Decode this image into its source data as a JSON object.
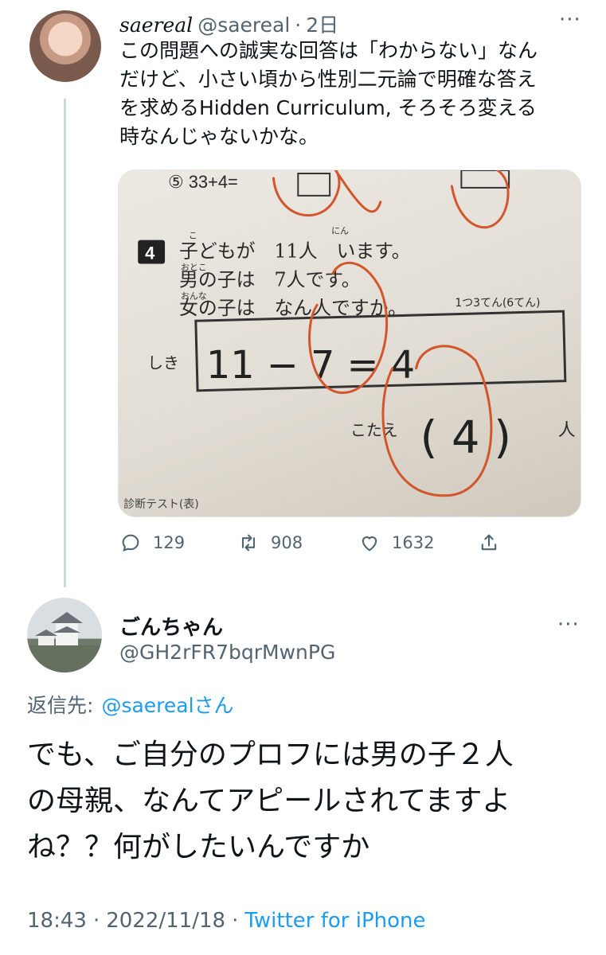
{
  "tweet1": {
    "display_name": "saereal",
    "handle": "@saereal",
    "separator": "·",
    "time": "2日",
    "more": "···",
    "text": "この問題への誠実な回答は「わからない」なん\nだけど、小さい頃から性別二元論で明確な答え\nを求めるHidden Curriculum, そろそろ変える\n時なんじゃないかな。",
    "media": {
      "problem_top": "⑤ 33+4=",
      "problem_number": "4",
      "line1": "子どもが　11人　います。",
      "line2": "男の子は　7人です。",
      "line3": "女の子は　なん人ですか。",
      "points": "1つ3てん(6てん)",
      "ruby_ko": "こ",
      "ruby_nin": "にん",
      "ruby_otoko": "おとこ",
      "ruby_onna": "おんな",
      "shiki_label": "しき",
      "shiki_answer": "11 − 7 = 4",
      "kotae_label": "こたえ",
      "kotae_answer": "( 4 )",
      "kotae_unit": "人",
      "footer": "診断テスト(表)"
    },
    "stats": {
      "replies": "129",
      "retweets": "908",
      "likes": "1632"
    }
  },
  "tweet2": {
    "display_name": "ごんちゃん",
    "handle": "@GH2rFR7bqrMwnPG",
    "more": "···",
    "reply_label": "返信先:",
    "reply_mention": "@saereal",
    "reply_suffix": "さん",
    "text": "でも、ご自分のプロフには男の子２人\nの母親、なんてアピールされてますよ\nね？？何がしたいんですか",
    "time": "18:43",
    "sep1": "·",
    "date": "2022/11/18",
    "sep2": "·",
    "source": "Twitter for iPhone"
  },
  "colors": {
    "text": "#0f1419",
    "secondary": "#536471",
    "link": "#1d9bf0",
    "thread_line": "#cfd9de",
    "pen_red": "#d2552b"
  },
  "icons": [
    "reply-icon",
    "retweet-icon",
    "like-icon",
    "share-icon",
    "more-icon"
  ]
}
